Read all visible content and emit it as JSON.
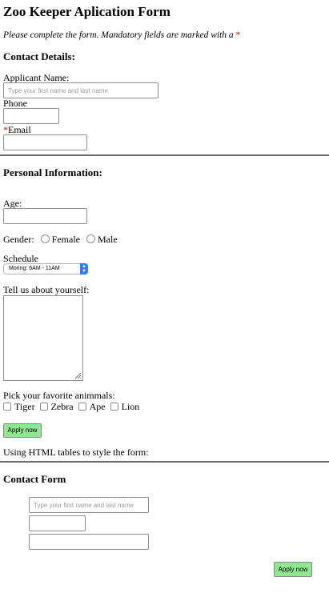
{
  "page": {
    "title": "Zoo Keeper Aplication Form",
    "intro": "Please complete the form. Mandatory fields are marked with a ",
    "required_mark": "*"
  },
  "contact": {
    "heading": "Contact Details:",
    "name_label": "Applicant Name:",
    "name_placeholder": "Type your first name and last name",
    "phone_label": "Phone",
    "email_label": "Email"
  },
  "personal": {
    "heading": "Personal Information:",
    "age_label": "Age:",
    "gender_label": "Gender:",
    "gender_options": [
      "Female",
      "Male"
    ],
    "schedule_label": "Schedule",
    "schedule_value": "Moring: 6AM - 11AM",
    "about_label": "Tell us about yourself:",
    "animals_label": "Pick your favorite animmals:",
    "animals": [
      "Tiger",
      "Zebra",
      "Ape",
      "Lion"
    ],
    "apply_label": "Apply now"
  },
  "tables_note": "Using HTML tables to style the form:",
  "contact_form": {
    "heading": "Contact Form",
    "name_placeholder": "Type your first name and last name",
    "apply_label": "Apply now"
  },
  "colors": {
    "button_bg": "#8ee88e",
    "required": "#d40000",
    "select_arrow": "#2f7cf6"
  }
}
